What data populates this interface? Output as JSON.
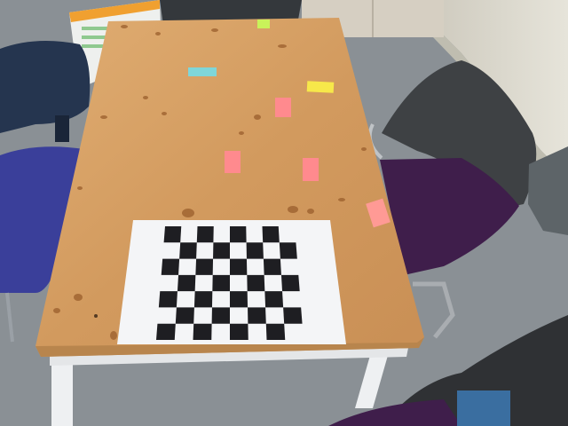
{
  "scene": {
    "description_type": "photo",
    "colors": {
      "floor": "#8a9095",
      "wall": "#d9d6c8",
      "table_wood": "#d8a569",
      "table_legs": "#eef0f2",
      "chair_dark": "#3e4144",
      "seat_purple": "#3f1e4b",
      "chair_blue": "#3a3f9a",
      "chair_navy": "#25354f",
      "paper": "#f4f5f7",
      "checker_dark": "#1e1e22"
    },
    "checkerboard": {
      "rows": 7,
      "cols": 8
    },
    "sticky_notes": [
      {
        "color": "#c9f25a"
      },
      {
        "color": "#7fd6d9"
      },
      {
        "color": "#f7e84a"
      },
      {
        "color": "#ff8a8e"
      },
      {
        "color": "#ff8a8e"
      },
      {
        "color": "#ff8a8e"
      },
      {
        "color": "#ff9a95"
      }
    ]
  }
}
